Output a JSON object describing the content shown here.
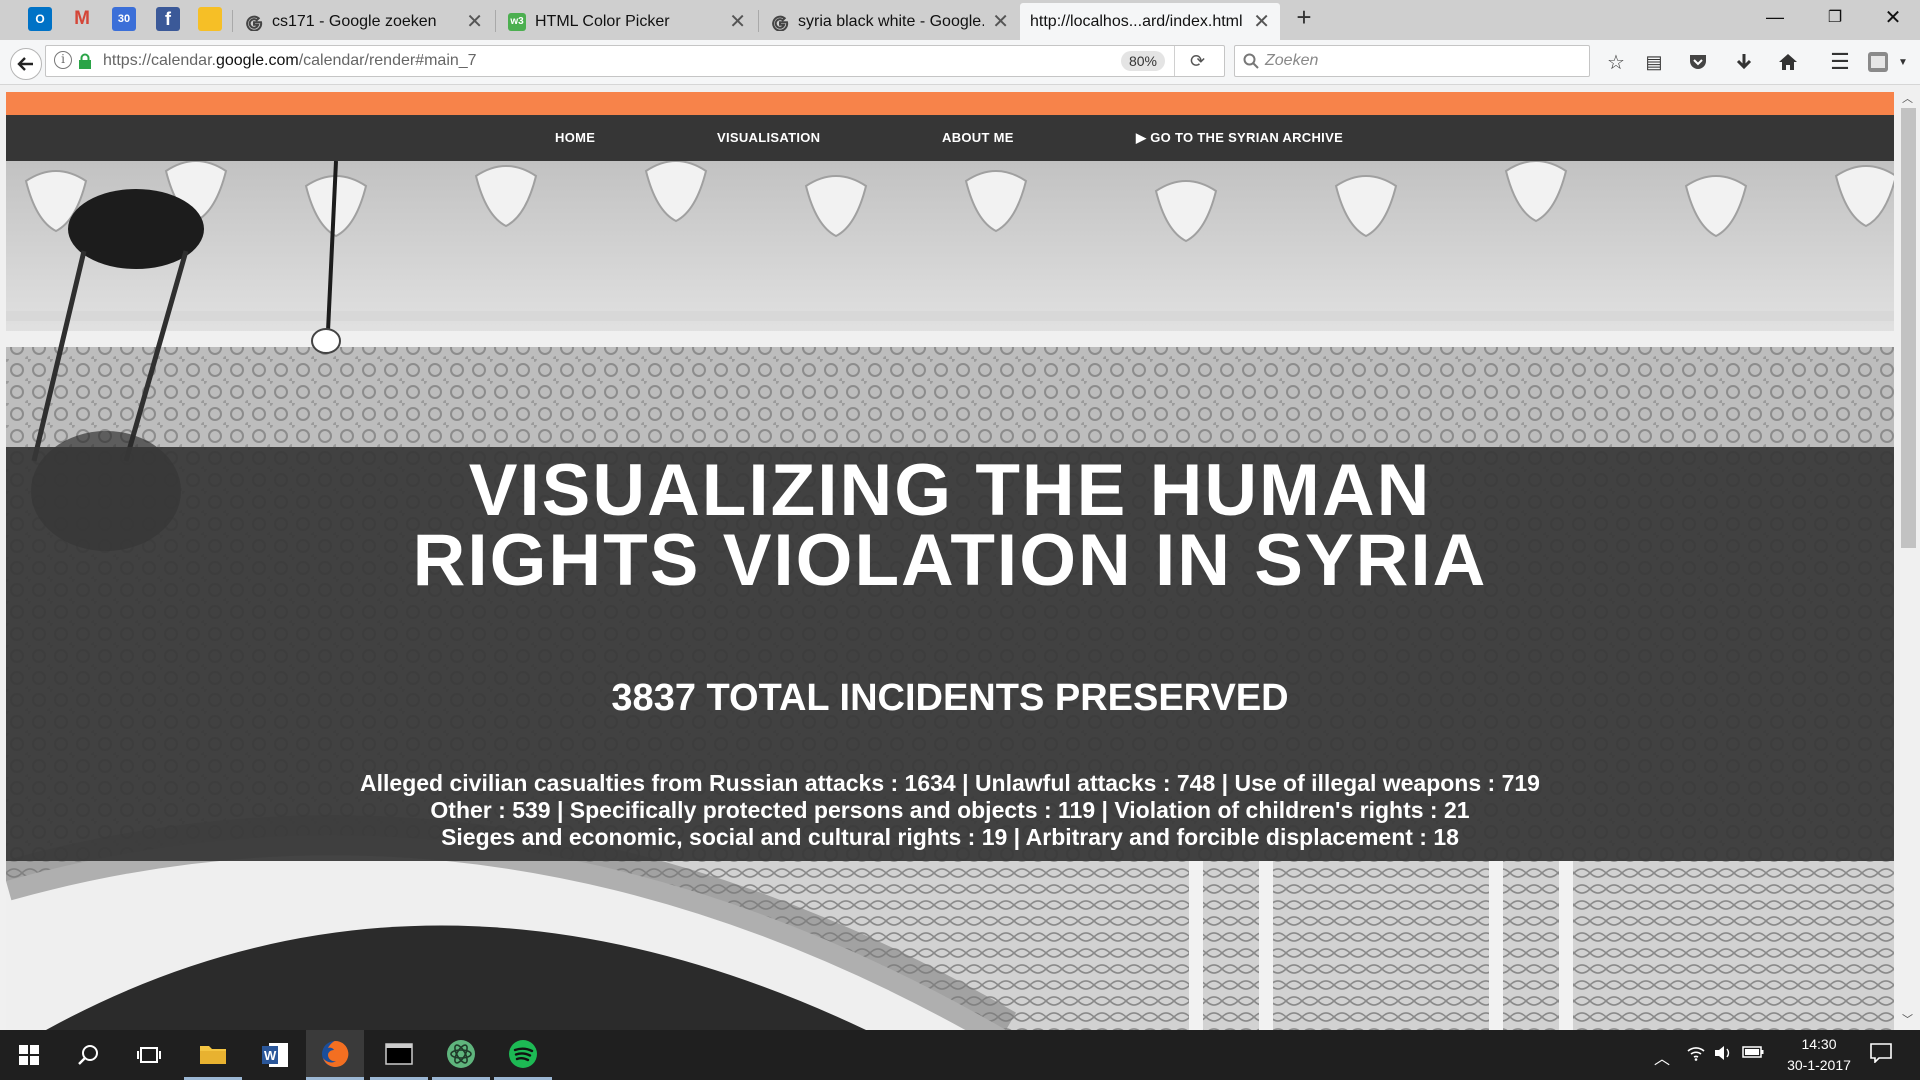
{
  "browser": {
    "pinned_tabs": [
      {
        "icon": "outlook-icon",
        "text": "O",
        "color": "#0072c6"
      },
      {
        "icon": "gmail-icon",
        "text": "M",
        "color": "#d44638"
      },
      {
        "icon": "google-calendar-icon",
        "text": "30",
        "color": "#3b6fd8"
      },
      {
        "icon": "facebook-icon",
        "text": "f",
        "color": "#3b5998"
      },
      {
        "icon": "google-keep-icon",
        "text": "",
        "color": "#f6bf26"
      }
    ],
    "tabs": [
      {
        "label": "cs171 - Google zoeken",
        "icon": "google-icon"
      },
      {
        "label": "HTML Color Picker",
        "icon": "w3schools-icon"
      },
      {
        "label": "syria black white - Google...",
        "icon": "google-icon"
      },
      {
        "label": "http://localhos...ard/index.html",
        "icon": "",
        "active": true
      }
    ],
    "new_tab": "+",
    "url_prefix": "https://calendar.",
    "url_domain": "google.com",
    "url_suffix": "/calendar/render#main_7",
    "zoom": "80%",
    "search_placeholder": "Zoeken"
  },
  "site": {
    "nav": [
      "HOME",
      "VISUALISATION",
      "ABOUT ME",
      "▶ GO TO THE SYRIAN ARCHIVE"
    ],
    "title_line1": "VISUALIZING THE HUMAN",
    "title_line2": "RIGHTS VIOLATION IN SYRIA",
    "subtitle": "3837 TOTAL INCIDENTS PRESERVED",
    "stats_line1": "Alleged civilian casualties from Russian attacks : 1634 | Unlawful attacks : 748 | Use of illegal weapons : 719",
    "stats_line2": "Other : 539 | Specifically protected persons and objects : 119 | Violation of children's rights : 21",
    "stats_line3": "Sieges and economic, social and cultural rights : 19 | Arbitrary and forcible displacement : 18",
    "accent_color": "#f7834a",
    "nav_color": "#363636"
  },
  "taskbar": {
    "apps": [
      "windows-start-icon",
      "search-icon",
      "task-view-icon",
      "file-explorer-icon",
      "word-icon",
      "firefox-icon",
      "terminal-icon",
      "atom-icon",
      "spotify-icon"
    ],
    "time": "14:30",
    "date": "30-1-2017"
  }
}
